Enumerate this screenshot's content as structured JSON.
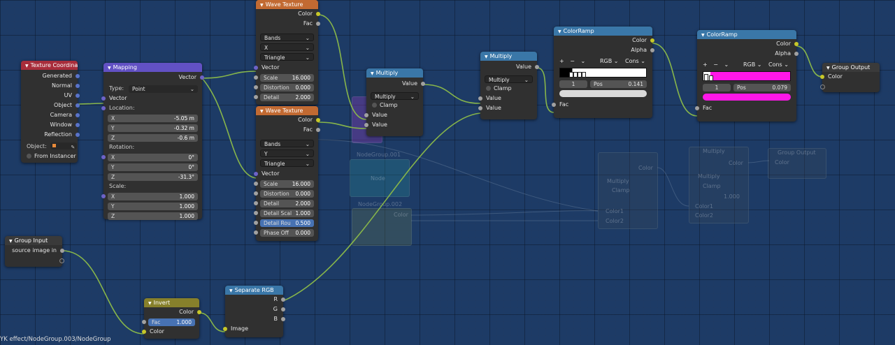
{
  "editor": {
    "breadcrumb": "YK effect/NodeGroup.003/NodeGroup"
  },
  "colors": {
    "texture_header": "#a82d3b",
    "vector_header": "#6251c4",
    "texture2_header": "#c26a32",
    "converter_header": "#3a77a8",
    "color_header": "#87802b",
    "background": "#1d3b66"
  },
  "nodes": {
    "texcoord": {
      "title": "Texture Coordinate",
      "outputs": [
        "Generated",
        "Normal",
        "UV",
        "Object",
        "Camera",
        "Window",
        "Reflection"
      ],
      "object_label": "Object:",
      "from_instancer": "From Instancer"
    },
    "mapping": {
      "title": "Mapping",
      "output": "Vector",
      "type_label": "Type:",
      "type_value": "Point",
      "input": "Vector",
      "location_label": "Location:",
      "location": [
        {
          "axis": "X",
          "value": "-5.05 m"
        },
        {
          "axis": "Y",
          "value": "-0.32 m"
        },
        {
          "axis": "Z",
          "value": "-0.6 m"
        }
      ],
      "rotation_label": "Rotation:",
      "rotation": [
        {
          "axis": "X",
          "value": "0°"
        },
        {
          "axis": "Y",
          "value": "0°"
        },
        {
          "axis": "Z",
          "value": "-31.3°"
        }
      ],
      "scale_label": "Scale:",
      "scale": [
        {
          "axis": "X",
          "value": "1.000"
        },
        {
          "axis": "Y",
          "value": "1.000"
        },
        {
          "axis": "Z",
          "value": "1.000"
        }
      ]
    },
    "wave1": {
      "title": "Wave Texture",
      "outputs": [
        "Color",
        "Fac"
      ],
      "type": "Bands",
      "direction": "X",
      "profile": "Triangle",
      "input_vector": "Vector",
      "fields": [
        {
          "label": "Scale",
          "value": "16.000"
        },
        {
          "label": "Distortion",
          "value": "0.000"
        },
        {
          "label": "Detail",
          "value": "2.000"
        }
      ]
    },
    "wave2": {
      "title": "Wave Texture",
      "outputs": [
        "Color",
        "Fac"
      ],
      "type": "Bands",
      "direction": "Y",
      "profile": "Triangle",
      "input_vector": "Vector",
      "fields": [
        {
          "label": "Scale",
          "value": "16.000"
        },
        {
          "label": "Distortion",
          "value": "0.000"
        },
        {
          "label": "Detail",
          "value": "2.000"
        },
        {
          "label": "Detail Scal",
          "value": "1.000"
        },
        {
          "label": "Detail Rou",
          "value": "0.500"
        },
        {
          "label": "Phase Off",
          "value": "0.000"
        }
      ]
    },
    "multiply1": {
      "title": "Multiply",
      "output": "Value",
      "operation": "Multiply",
      "clamp": "Clamp",
      "inputs": [
        "Value",
        "Value"
      ]
    },
    "multiply2": {
      "title": "Multiply",
      "output": "Value",
      "operation": "Multiply",
      "clamp": "Clamp",
      "inputs": [
        "Value",
        "Value"
      ]
    },
    "ramp1": {
      "title": "ColorRamp",
      "outputs": [
        "Color",
        "Alpha"
      ],
      "plus": "+",
      "minus": "−",
      "chev": "⌄",
      "mode": "RGB",
      "interp": "Cons",
      "index": "1",
      "pos_label": "Pos",
      "pos_value": "0.141",
      "input": "Fac",
      "color_a": "#000000",
      "color_b": "#ffffff",
      "swatch": "#d9d9d9"
    },
    "ramp2": {
      "title": "ColorRamp",
      "outputs": [
        "Color",
        "Alpha"
      ],
      "plus": "+",
      "minus": "−",
      "chev": "⌄",
      "mode": "RGB",
      "interp": "Cons",
      "index": "1",
      "pos_label": "Pos",
      "pos_value": "0.079",
      "input": "Fac",
      "color_a": "#ffffff",
      "color_b": "#ff17e8",
      "swatch": "#ff17e8"
    },
    "group_output": {
      "title": "Group Output",
      "input": "Color"
    },
    "group_input": {
      "title": "Group Input",
      "output": "source image in"
    },
    "invert": {
      "title": "Invert",
      "output": "Color",
      "fac_label": "Fac",
      "fac_value": "1.000",
      "input": "Color"
    },
    "separate": {
      "title": "Separate RGB",
      "outputs": [
        "R",
        "G",
        "B"
      ],
      "input": "Image"
    }
  },
  "ghosts": {
    "nodegroup1": "NodeGroup.001",
    "node_label": "Node",
    "nodegroup2": "NodeGroup.002",
    "multiply": "Multiply",
    "color": "Color",
    "color1": "Color1",
    "color2": "Color2",
    "value_field": "1.000",
    "group_output": "Group Output",
    "clamp": "Clamp"
  }
}
